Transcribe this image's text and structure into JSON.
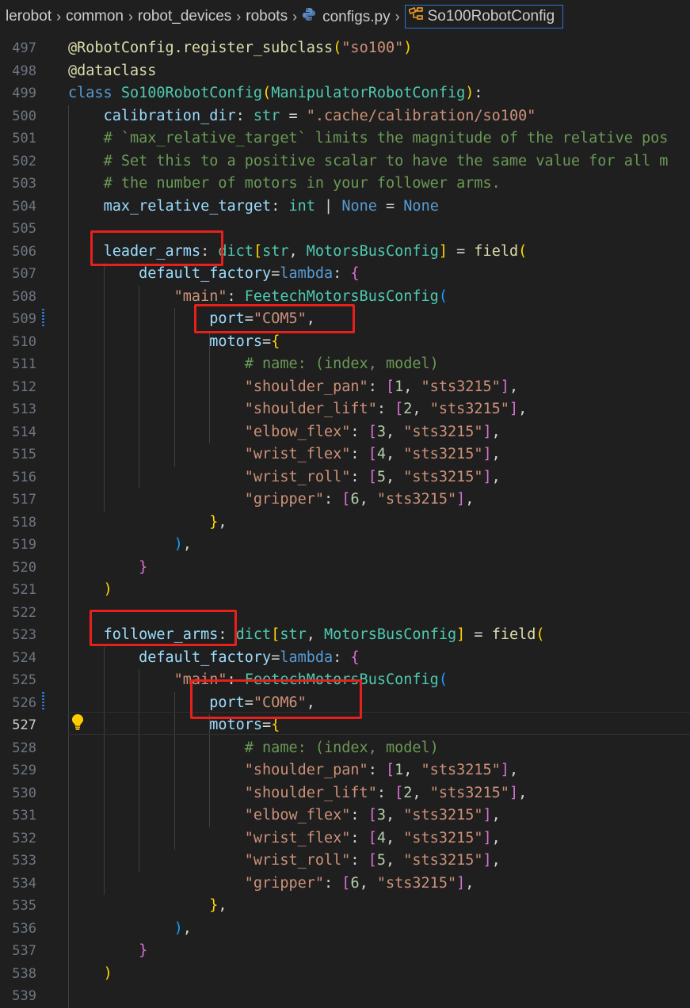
{
  "breadcrumb": {
    "items": [
      "lerobot",
      "common",
      "robot_devices",
      "robots"
    ],
    "file": "configs.py",
    "symbol": "So100RobotConfig"
  },
  "editor": {
    "active_line": "527",
    "lines": [
      {
        "num": "497",
        "tokens": [
          [
            "f",
            "@RobotConfig"
          ],
          [
            "op",
            "."
          ],
          [
            "f",
            "register_subclass"
          ],
          [
            "b1",
            "("
          ],
          [
            "s",
            "\"so100\""
          ],
          [
            "b1",
            ")"
          ]
        ]
      },
      {
        "num": "498",
        "tokens": [
          [
            "f",
            "@dataclass"
          ]
        ]
      },
      {
        "num": "499",
        "tokens": [
          [
            "k",
            "class"
          ],
          [
            "op",
            " "
          ],
          [
            "c",
            "So100RobotConfig"
          ],
          [
            "b1",
            "("
          ],
          [
            "c",
            "ManipulatorRobotConfig"
          ],
          [
            "b1",
            ")"
          ],
          [
            "op",
            ":"
          ]
        ]
      },
      {
        "num": "500",
        "tokens": [
          [
            "op",
            "    "
          ],
          [
            "v",
            "calibration_dir"
          ],
          [
            "op",
            ": "
          ],
          [
            "c",
            "str"
          ],
          [
            "op",
            " = "
          ],
          [
            "s",
            "\".cache/calibration/so100\""
          ]
        ]
      },
      {
        "num": "501",
        "tokens": [
          [
            "op",
            "    "
          ],
          [
            "cm",
            "# `max_relative_target` limits the magnitude of the relative pos"
          ]
        ]
      },
      {
        "num": "502",
        "tokens": [
          [
            "op",
            "    "
          ],
          [
            "cm",
            "# Set this to a positive scalar to have the same value for all m"
          ]
        ]
      },
      {
        "num": "503",
        "tokens": [
          [
            "op",
            "    "
          ],
          [
            "cm",
            "# the number of motors in your follower arms."
          ]
        ]
      },
      {
        "num": "504",
        "tokens": [
          [
            "op",
            "    "
          ],
          [
            "v",
            "max_relative_target"
          ],
          [
            "op",
            ": "
          ],
          [
            "c",
            "int"
          ],
          [
            "op",
            " | "
          ],
          [
            "k",
            "None"
          ],
          [
            "op",
            " = "
          ],
          [
            "k",
            "None"
          ]
        ]
      },
      {
        "num": "505",
        "tokens": []
      },
      {
        "num": "506",
        "tokens": [
          [
            "op",
            "    "
          ],
          [
            "v",
            "leader_arms"
          ],
          [
            "op",
            ": "
          ],
          [
            "c",
            "dict"
          ],
          [
            "b1",
            "["
          ],
          [
            "c",
            "str"
          ],
          [
            "op",
            ", "
          ],
          [
            "c",
            "MotorsBusConfig"
          ],
          [
            "b1",
            "]"
          ],
          [
            "op",
            " = "
          ],
          [
            "f",
            "field"
          ],
          [
            "b1",
            "("
          ]
        ]
      },
      {
        "num": "507",
        "tokens": [
          [
            "op",
            "        "
          ],
          [
            "v",
            "default_factory"
          ],
          [
            "op",
            "="
          ],
          [
            "k",
            "lambda"
          ],
          [
            "op",
            ": "
          ],
          [
            "b2",
            "{"
          ]
        ]
      },
      {
        "num": "508",
        "tokens": [
          [
            "op",
            "            "
          ],
          [
            "s",
            "\"main\""
          ],
          [
            "op",
            ": "
          ],
          [
            "c",
            "FeetechMotorsBusConfig"
          ],
          [
            "b3",
            "("
          ]
        ]
      },
      {
        "num": "509",
        "tokens": [
          [
            "op",
            "                "
          ],
          [
            "v",
            "port"
          ],
          [
            "op",
            "="
          ],
          [
            "s",
            "\"COM5\""
          ],
          [
            "op",
            ","
          ]
        ]
      },
      {
        "num": "510",
        "tokens": [
          [
            "op",
            "                "
          ],
          [
            "v",
            "motors"
          ],
          [
            "op",
            "="
          ],
          [
            "b1",
            "{"
          ]
        ]
      },
      {
        "num": "511",
        "tokens": [
          [
            "op",
            "                    "
          ],
          [
            "cm",
            "# name: (index, model)"
          ]
        ]
      },
      {
        "num": "512",
        "tokens": [
          [
            "op",
            "                    "
          ],
          [
            "s",
            "\"shoulder_pan\""
          ],
          [
            "op",
            ": "
          ],
          [
            "b2",
            "["
          ],
          [
            "n",
            "1"
          ],
          [
            "op",
            ", "
          ],
          [
            "s",
            "\"sts3215\""
          ],
          [
            "b2",
            "]"
          ],
          [
            "op",
            ","
          ]
        ]
      },
      {
        "num": "513",
        "tokens": [
          [
            "op",
            "                    "
          ],
          [
            "s",
            "\"shoulder_lift\""
          ],
          [
            "op",
            ": "
          ],
          [
            "b2",
            "["
          ],
          [
            "n",
            "2"
          ],
          [
            "op",
            ", "
          ],
          [
            "s",
            "\"sts3215\""
          ],
          [
            "b2",
            "]"
          ],
          [
            "op",
            ","
          ]
        ]
      },
      {
        "num": "514",
        "tokens": [
          [
            "op",
            "                    "
          ],
          [
            "s",
            "\"elbow_flex\""
          ],
          [
            "op",
            ": "
          ],
          [
            "b2",
            "["
          ],
          [
            "n",
            "3"
          ],
          [
            "op",
            ", "
          ],
          [
            "s",
            "\"sts3215\""
          ],
          [
            "b2",
            "]"
          ],
          [
            "op",
            ","
          ]
        ]
      },
      {
        "num": "515",
        "tokens": [
          [
            "op",
            "                    "
          ],
          [
            "s",
            "\"wrist_flex\""
          ],
          [
            "op",
            ": "
          ],
          [
            "b2",
            "["
          ],
          [
            "n",
            "4"
          ],
          [
            "op",
            ", "
          ],
          [
            "s",
            "\"sts3215\""
          ],
          [
            "b2",
            "]"
          ],
          [
            "op",
            ","
          ]
        ]
      },
      {
        "num": "516",
        "tokens": [
          [
            "op",
            "                    "
          ],
          [
            "s",
            "\"wrist_roll\""
          ],
          [
            "op",
            ": "
          ],
          [
            "b2",
            "["
          ],
          [
            "n",
            "5"
          ],
          [
            "op",
            ", "
          ],
          [
            "s",
            "\"sts3215\""
          ],
          [
            "b2",
            "]"
          ],
          [
            "op",
            ","
          ]
        ]
      },
      {
        "num": "517",
        "tokens": [
          [
            "op",
            "                    "
          ],
          [
            "s",
            "\"gripper\""
          ],
          [
            "op",
            ": "
          ],
          [
            "b2",
            "["
          ],
          [
            "n",
            "6"
          ],
          [
            "op",
            ", "
          ],
          [
            "s",
            "\"sts3215\""
          ],
          [
            "b2",
            "]"
          ],
          [
            "op",
            ","
          ]
        ]
      },
      {
        "num": "518",
        "tokens": [
          [
            "op",
            "                "
          ],
          [
            "b1",
            "}"
          ],
          [
            "op",
            ","
          ]
        ]
      },
      {
        "num": "519",
        "tokens": [
          [
            "op",
            "            "
          ],
          [
            "b3",
            ")"
          ],
          [
            "op",
            ","
          ]
        ]
      },
      {
        "num": "520",
        "tokens": [
          [
            "op",
            "        "
          ],
          [
            "b2",
            "}"
          ]
        ]
      },
      {
        "num": "521",
        "tokens": [
          [
            "op",
            "    "
          ],
          [
            "b1",
            ")"
          ]
        ]
      },
      {
        "num": "522",
        "tokens": []
      },
      {
        "num": "523",
        "tokens": [
          [
            "op",
            "    "
          ],
          [
            "v",
            "follower_arms"
          ],
          [
            "op",
            ": "
          ],
          [
            "c",
            "dict"
          ],
          [
            "b1",
            "["
          ],
          [
            "c",
            "str"
          ],
          [
            "op",
            ", "
          ],
          [
            "c",
            "MotorsBusConfig"
          ],
          [
            "b1",
            "]"
          ],
          [
            "op",
            " = "
          ],
          [
            "f",
            "field"
          ],
          [
            "b1",
            "("
          ]
        ]
      },
      {
        "num": "524",
        "tokens": [
          [
            "op",
            "        "
          ],
          [
            "v",
            "default_factory"
          ],
          [
            "op",
            "="
          ],
          [
            "k",
            "lambda"
          ],
          [
            "op",
            ": "
          ],
          [
            "b2",
            "{"
          ]
        ]
      },
      {
        "num": "525",
        "tokens": [
          [
            "op",
            "            "
          ],
          [
            "s",
            "\"main\""
          ],
          [
            "op",
            ": "
          ],
          [
            "c",
            "FeetechMotorsBusConfig"
          ],
          [
            "b3",
            "("
          ]
        ]
      },
      {
        "num": "526",
        "tokens": [
          [
            "op",
            "                "
          ],
          [
            "v",
            "port"
          ],
          [
            "op",
            "="
          ],
          [
            "s",
            "\"COM6\""
          ],
          [
            "op",
            ","
          ]
        ]
      },
      {
        "num": "527",
        "tokens": [
          [
            "op",
            "                "
          ],
          [
            "v",
            "motors"
          ],
          [
            "op",
            "="
          ],
          [
            "b1",
            "{"
          ]
        ]
      },
      {
        "num": "528",
        "tokens": [
          [
            "op",
            "                    "
          ],
          [
            "cm",
            "# name: (index, model)"
          ]
        ]
      },
      {
        "num": "529",
        "tokens": [
          [
            "op",
            "                    "
          ],
          [
            "s",
            "\"shoulder_pan\""
          ],
          [
            "op",
            ": "
          ],
          [
            "b2",
            "["
          ],
          [
            "n",
            "1"
          ],
          [
            "op",
            ", "
          ],
          [
            "s",
            "\"sts3215\""
          ],
          [
            "b2",
            "]"
          ],
          [
            "op",
            ","
          ]
        ]
      },
      {
        "num": "530",
        "tokens": [
          [
            "op",
            "                    "
          ],
          [
            "s",
            "\"shoulder_lift\""
          ],
          [
            "op",
            ": "
          ],
          [
            "b2",
            "["
          ],
          [
            "n",
            "2"
          ],
          [
            "op",
            ", "
          ],
          [
            "s",
            "\"sts3215\""
          ],
          [
            "b2",
            "]"
          ],
          [
            "op",
            ","
          ]
        ]
      },
      {
        "num": "531",
        "tokens": [
          [
            "op",
            "                    "
          ],
          [
            "s",
            "\"elbow_flex\""
          ],
          [
            "op",
            ": "
          ],
          [
            "b2",
            "["
          ],
          [
            "n",
            "3"
          ],
          [
            "op",
            ", "
          ],
          [
            "s",
            "\"sts3215\""
          ],
          [
            "b2",
            "]"
          ],
          [
            "op",
            ","
          ]
        ]
      },
      {
        "num": "532",
        "tokens": [
          [
            "op",
            "                    "
          ],
          [
            "s",
            "\"wrist_flex\""
          ],
          [
            "op",
            ": "
          ],
          [
            "b2",
            "["
          ],
          [
            "n",
            "4"
          ],
          [
            "op",
            ", "
          ],
          [
            "s",
            "\"sts3215\""
          ],
          [
            "b2",
            "]"
          ],
          [
            "op",
            ","
          ]
        ]
      },
      {
        "num": "533",
        "tokens": [
          [
            "op",
            "                    "
          ],
          [
            "s",
            "\"wrist_roll\""
          ],
          [
            "op",
            ": "
          ],
          [
            "b2",
            "["
          ],
          [
            "n",
            "5"
          ],
          [
            "op",
            ", "
          ],
          [
            "s",
            "\"sts3215\""
          ],
          [
            "b2",
            "]"
          ],
          [
            "op",
            ","
          ]
        ]
      },
      {
        "num": "534",
        "tokens": [
          [
            "op",
            "                    "
          ],
          [
            "s",
            "\"gripper\""
          ],
          [
            "op",
            ": "
          ],
          [
            "b2",
            "["
          ],
          [
            "n",
            "6"
          ],
          [
            "op",
            ", "
          ],
          [
            "s",
            "\"sts3215\""
          ],
          [
            "b2",
            "]"
          ],
          [
            "op",
            ","
          ]
        ]
      },
      {
        "num": "535",
        "tokens": [
          [
            "op",
            "                "
          ],
          [
            "b1",
            "}"
          ],
          [
            "op",
            ","
          ]
        ]
      },
      {
        "num": "536",
        "tokens": [
          [
            "op",
            "            "
          ],
          [
            "b3",
            ")"
          ],
          [
            "op",
            ","
          ]
        ]
      },
      {
        "num": "537",
        "tokens": [
          [
            "op",
            "        "
          ],
          [
            "b2",
            "}"
          ]
        ]
      },
      {
        "num": "538",
        "tokens": [
          [
            "op",
            "    "
          ],
          [
            "b1",
            ")"
          ]
        ]
      },
      {
        "num": "539",
        "tokens": []
      }
    ]
  }
}
